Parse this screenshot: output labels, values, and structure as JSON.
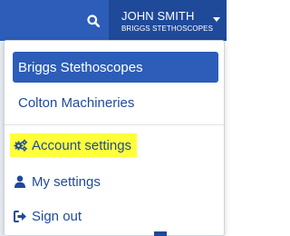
{
  "header": {
    "user": {
      "name": "JOHN SMITH",
      "company": "BRIGGS STETHOSCOPES"
    },
    "search_icon": "search-icon",
    "caret_icon": "caret-down-icon"
  },
  "dropdown": {
    "organizations": [
      {
        "label": "Briggs Stethoscopes",
        "active": true
      },
      {
        "label": "Colton Machineries",
        "active": false
      }
    ],
    "menu": [
      {
        "label": "Account settings",
        "icon": "gears-icon",
        "highlighted": true
      },
      {
        "label": "My settings",
        "icon": "user-icon",
        "highlighted": false
      },
      {
        "label": "Sign out",
        "icon": "sign-out-icon",
        "highlighted": false
      }
    ]
  },
  "colors": {
    "brand": "#2c5db8",
    "brand_dark": "#1f4a9a",
    "highlight": "#ffff3a"
  }
}
